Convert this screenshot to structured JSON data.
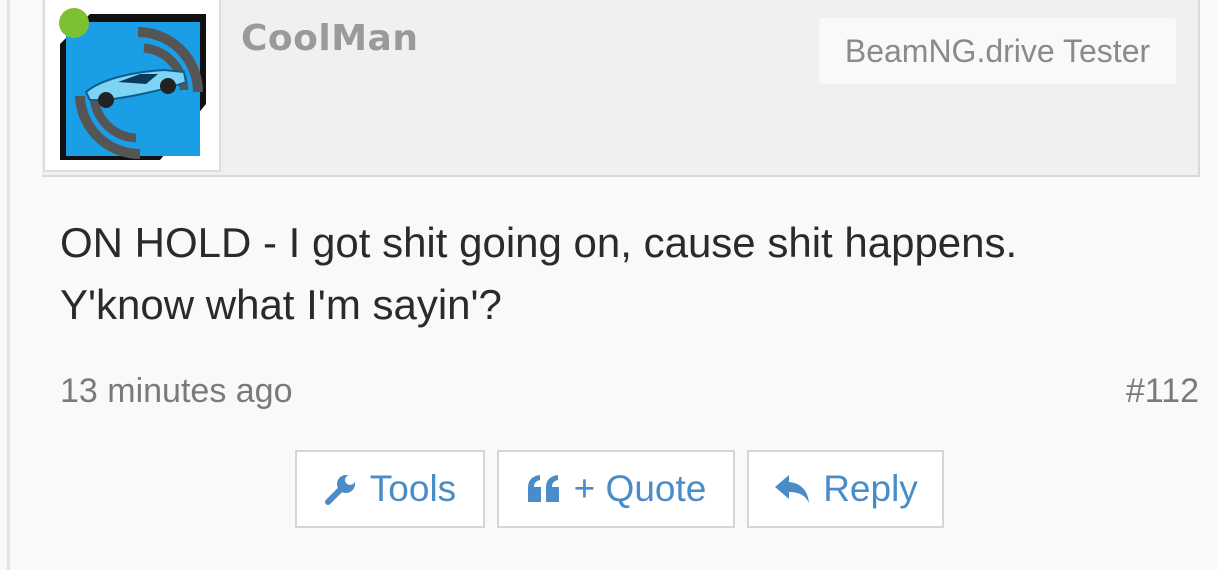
{
  "post": {
    "username": "CoolMan",
    "user_title": "BeamNG.drive Tester",
    "message_line1": "ON HOLD - I got shit going on, cause shit happens.",
    "message_line2": "Y'know what I'm sayin'?",
    "timestamp": "13 minutes ago",
    "post_number": "#112",
    "online_status_color": "#7cc132"
  },
  "actions": {
    "tools_label": "Tools",
    "tools_icon": "wrench-icon",
    "quote_label": "+ Quote",
    "quote_icon": "quote-icon",
    "reply_label": "Reply",
    "reply_icon": "reply-arrow-icon"
  },
  "colors": {
    "link": "#4a8cc7",
    "avatar_background": "#1a9ee6"
  }
}
